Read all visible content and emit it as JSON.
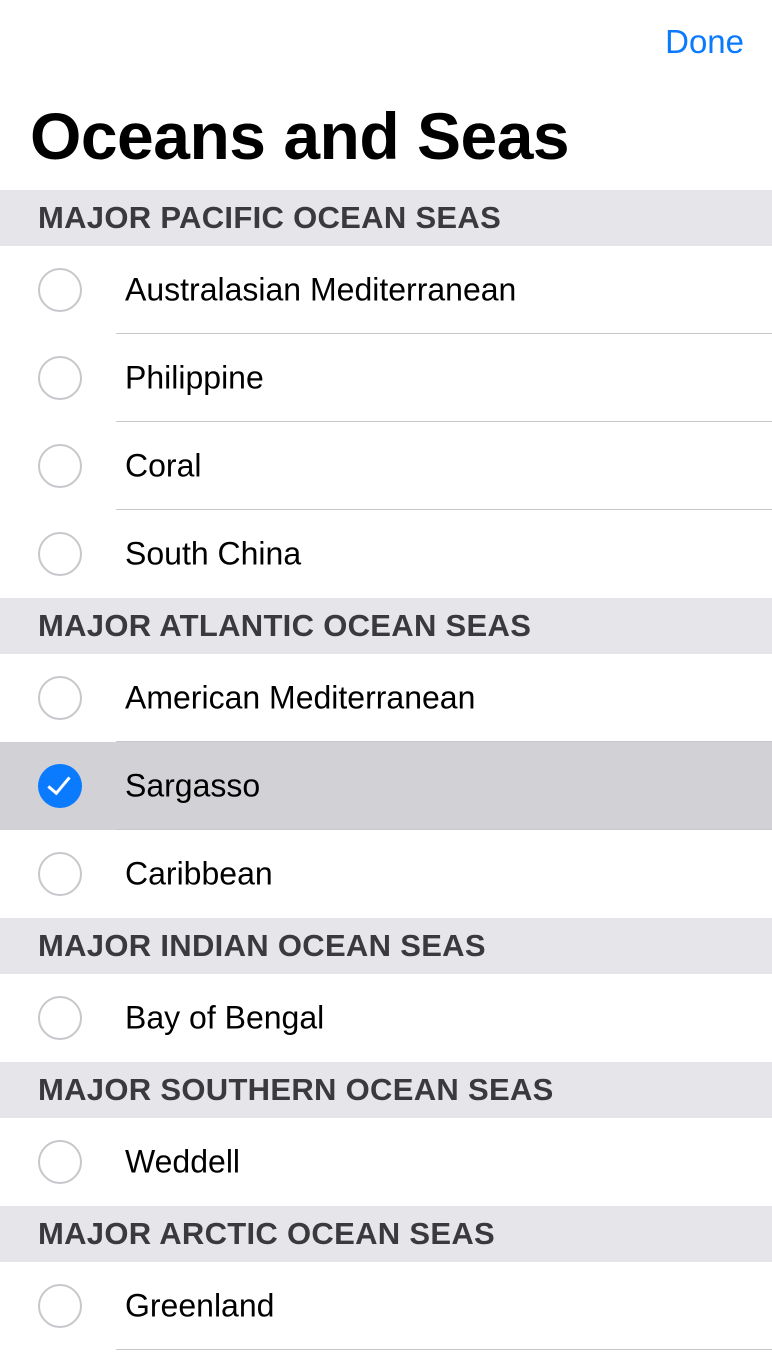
{
  "nav": {
    "done_label": "Done",
    "title": "Oceans and Seas"
  },
  "colors": {
    "accent": "#0a7aff",
    "section_bg": "#e5e5ea",
    "selected_row_bg": "#d1d1d6"
  },
  "sections": [
    {
      "header": "MAJOR PACIFIC OCEAN SEAS",
      "items": [
        {
          "label": "Australasian Mediterranean",
          "selected": false
        },
        {
          "label": "Philippine",
          "selected": false
        },
        {
          "label": "Coral",
          "selected": false
        },
        {
          "label": "South China",
          "selected": false
        }
      ]
    },
    {
      "header": "MAJOR ATLANTIC OCEAN SEAS",
      "items": [
        {
          "label": "American Mediterranean",
          "selected": false
        },
        {
          "label": "Sargasso",
          "selected": true
        },
        {
          "label": "Caribbean",
          "selected": false
        }
      ]
    },
    {
      "header": "MAJOR INDIAN OCEAN SEAS",
      "items": [
        {
          "label": "Bay of Bengal",
          "selected": false
        }
      ]
    },
    {
      "header": "MAJOR SOUTHERN OCEAN SEAS",
      "items": [
        {
          "label": "Weddell",
          "selected": false
        }
      ]
    },
    {
      "header": "MAJOR ARCTIC OCEAN SEAS",
      "items": [
        {
          "label": "Greenland",
          "selected": false
        }
      ]
    }
  ]
}
